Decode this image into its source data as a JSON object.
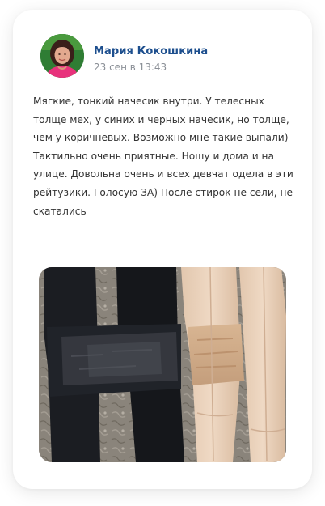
{
  "review": {
    "author_name": "Мария Кокошкина",
    "date": "23 сен в 13:43",
    "text": "Мягкие, тонкий начесик внутри. У телесных толще мех, у синих и черных начесик, но толще, чем у коричневых. Возможно мне такие выпали) Тактильно очень приятные. Ношу и дома и на улице. Довольна очень и всех девчат одела в эти рейтузики. Голосую ЗА) После стирок не сели, не скатались",
    "avatar_icon": "user-photo",
    "photo_subject": "product-photo"
  },
  "colors": {
    "author_name": "#1d4f8e",
    "date": "#8a8f96",
    "text": "#333333",
    "card_background": "#ffffff"
  }
}
